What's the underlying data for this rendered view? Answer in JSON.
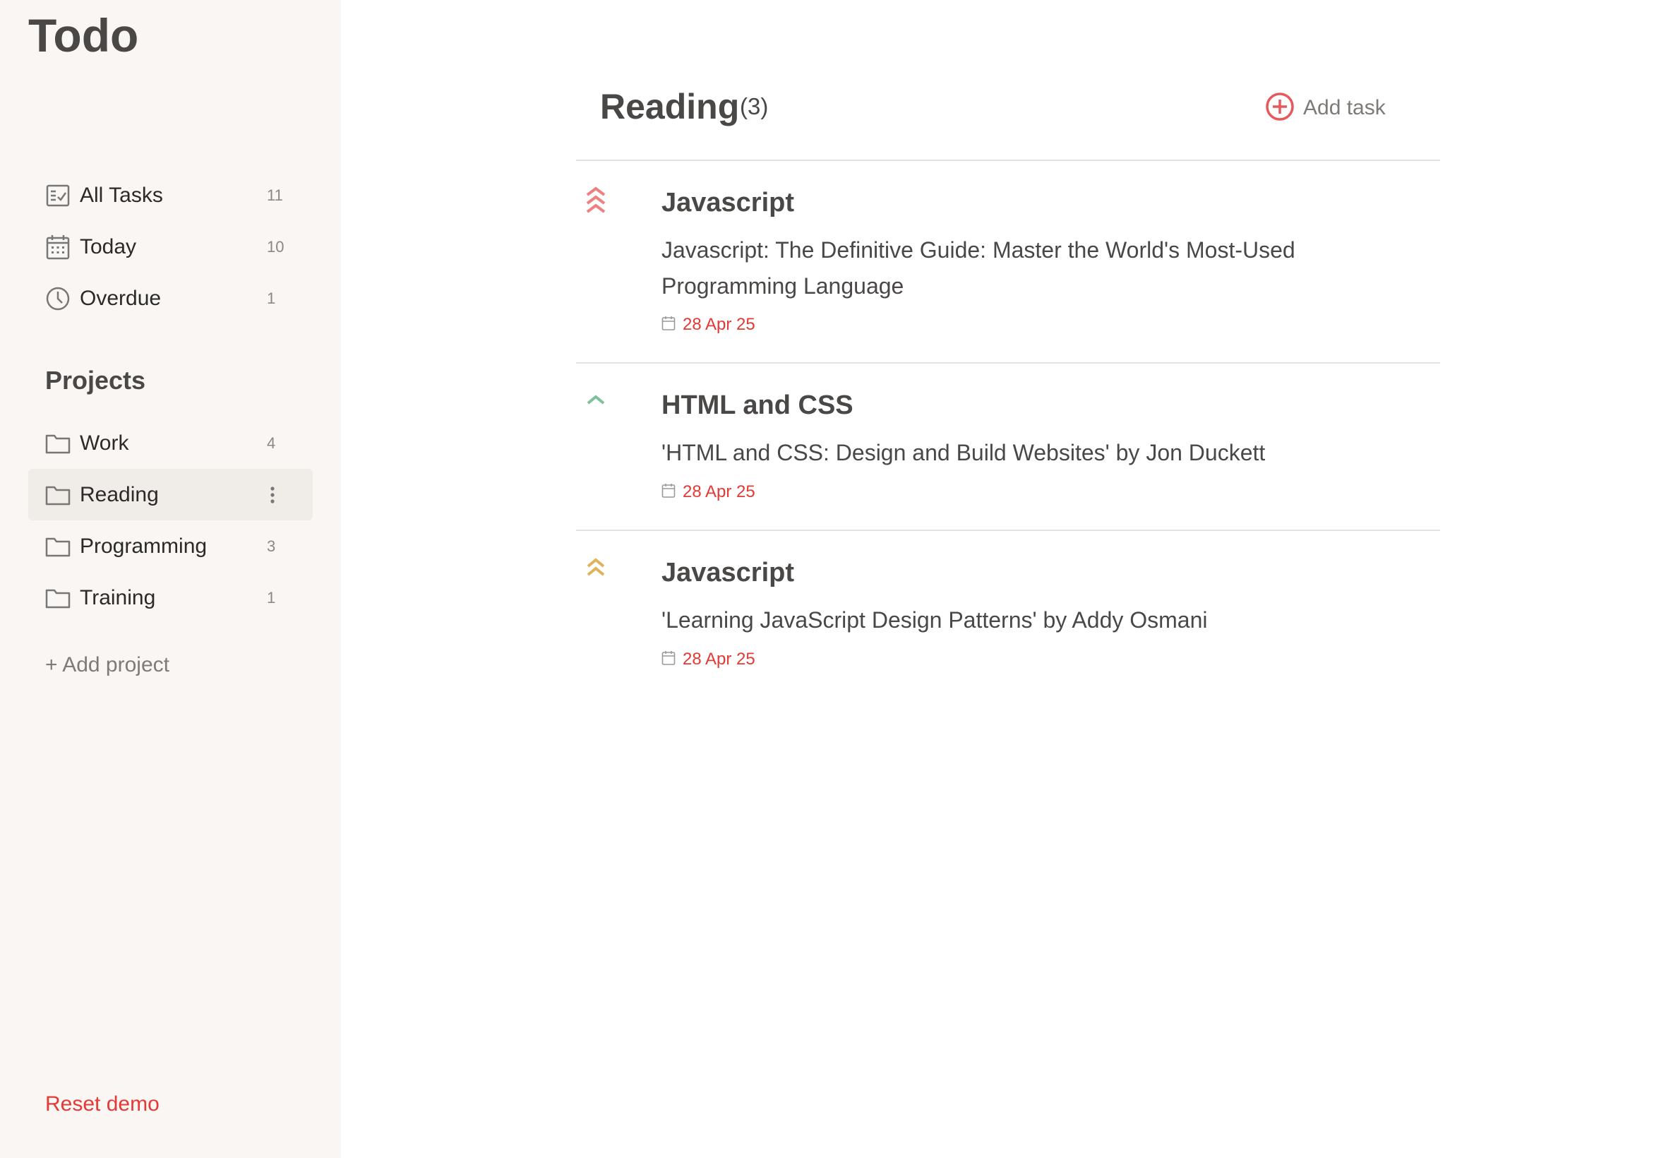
{
  "app": {
    "title": "Todo"
  },
  "sidebar": {
    "filters": [
      {
        "label": "All Tasks",
        "count": "11",
        "icon": "checklist-icon"
      },
      {
        "label": "Today",
        "count": "10",
        "icon": "calendar-icon"
      },
      {
        "label": "Overdue",
        "count": "1",
        "icon": "clock-icon"
      }
    ],
    "projects_heading": "Projects",
    "projects": [
      {
        "label": "Work",
        "count": "4",
        "icon": "folder-icon"
      },
      {
        "label": "Reading",
        "count": "",
        "icon": "folder-icon",
        "active": true
      },
      {
        "label": "Programming",
        "count": "3",
        "icon": "folder-icon"
      },
      {
        "label": "Training",
        "count": "1",
        "icon": "folder-icon"
      }
    ],
    "add_project": "+ Add project",
    "reset_demo": "Reset demo"
  },
  "main": {
    "title": "Reading",
    "count": "(3)",
    "add_task": "Add task",
    "tasks": [
      {
        "title": "Javascript",
        "description": "Javascript: The Definitive Guide: Master the World's Most-Used Programming Language",
        "date": "28 Apr 25",
        "priority": "high",
        "priority_icon": "triple-chevron-up-icon",
        "priority_color": "#f08080"
      },
      {
        "title": "HTML and CSS",
        "description": "'HTML and CSS: Design and Build Websites' by Jon Duckett",
        "date": "28 Apr 25",
        "priority": "low",
        "priority_icon": "chevron-up-icon",
        "priority_color": "#7fbf9a"
      },
      {
        "title": "Javascript",
        "description": "'Learning JavaScript Design Patterns' by Addy Osmani",
        "date": "28 Apr 25",
        "priority": "medium",
        "priority_icon": "double-chevron-up-icon",
        "priority_color": "#e0b35a"
      }
    ]
  },
  "colors": {
    "sidebar_bg": "#f9f6f3",
    "accent_red": "#e53935",
    "add_task_icon": "#e8585b"
  }
}
